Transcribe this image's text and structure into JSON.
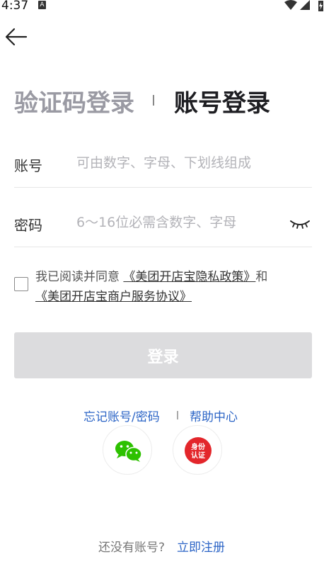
{
  "status_bar": {
    "time": "4:37",
    "notification_badge": "A"
  },
  "tabs": {
    "sms_login": "验证码登录",
    "account_login": "账号登录",
    "active": "account_login"
  },
  "account_field": {
    "label": "账号",
    "value": "",
    "placeholder": "可由数字、字母、下划线组成"
  },
  "password_field": {
    "label": "密码",
    "value": "",
    "placeholder": "6～16位必需含数字、字母"
  },
  "agreement": {
    "checked": false,
    "prefix": "我已阅读并同意",
    "privacy_link": "《美团开店宝隐私政策》",
    "and": "和",
    "service_link": "《美团开店宝商户服务协议》"
  },
  "login_button": {
    "label": "登录",
    "enabled": false
  },
  "help": {
    "forgot_link": "忘记账号/密码",
    "help_center_link": "帮助中心"
  },
  "social_login": {
    "wechat_icon": "wechat-icon",
    "identity_icon_text_1": "身份",
    "identity_icon_text_2": "认证"
  },
  "register": {
    "prompt": "还没有账号?",
    "link": "立即注册"
  },
  "colors": {
    "link": "#2b64c6",
    "login_disabled": "#dcdcde",
    "wechat": "#2dc100",
    "identity": "#e3262b"
  }
}
